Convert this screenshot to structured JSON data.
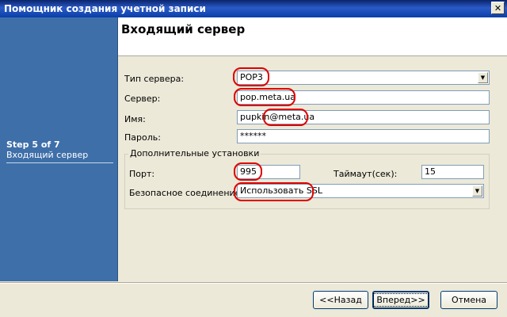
{
  "window": {
    "title": "Помощник создания учетной записи",
    "close_glyph": "✕"
  },
  "sidebar": {
    "step": "Step 5 of 7",
    "step_name": "Входящий сервер"
  },
  "header": {
    "title": "Входящий сервер"
  },
  "form": {
    "server_type": {
      "label": "Тип сервера:",
      "value": "POP3"
    },
    "server": {
      "label": "Сервер:",
      "value": "pop.meta.ua"
    },
    "name": {
      "label": "Имя:",
      "value": "pupkin@meta.ua"
    },
    "password": {
      "label": "Пароль:",
      "value": "******"
    },
    "advanced": {
      "legend": "Дополнительные установки",
      "port": {
        "label": "Порт:",
        "value": "995"
      },
      "timeout": {
        "label": "Таймаут(сек):",
        "value": "15"
      },
      "secure": {
        "label": "Безопасное соединение",
        "value": "Использовать SSL"
      }
    }
  },
  "buttons": {
    "back": "<<Назад",
    "next": "Вперед>>",
    "cancel": "Отмена"
  },
  "colors": {
    "sidebar": "#3e6fa8",
    "annotation": "#e00000",
    "titlebar": "#0a246a"
  }
}
